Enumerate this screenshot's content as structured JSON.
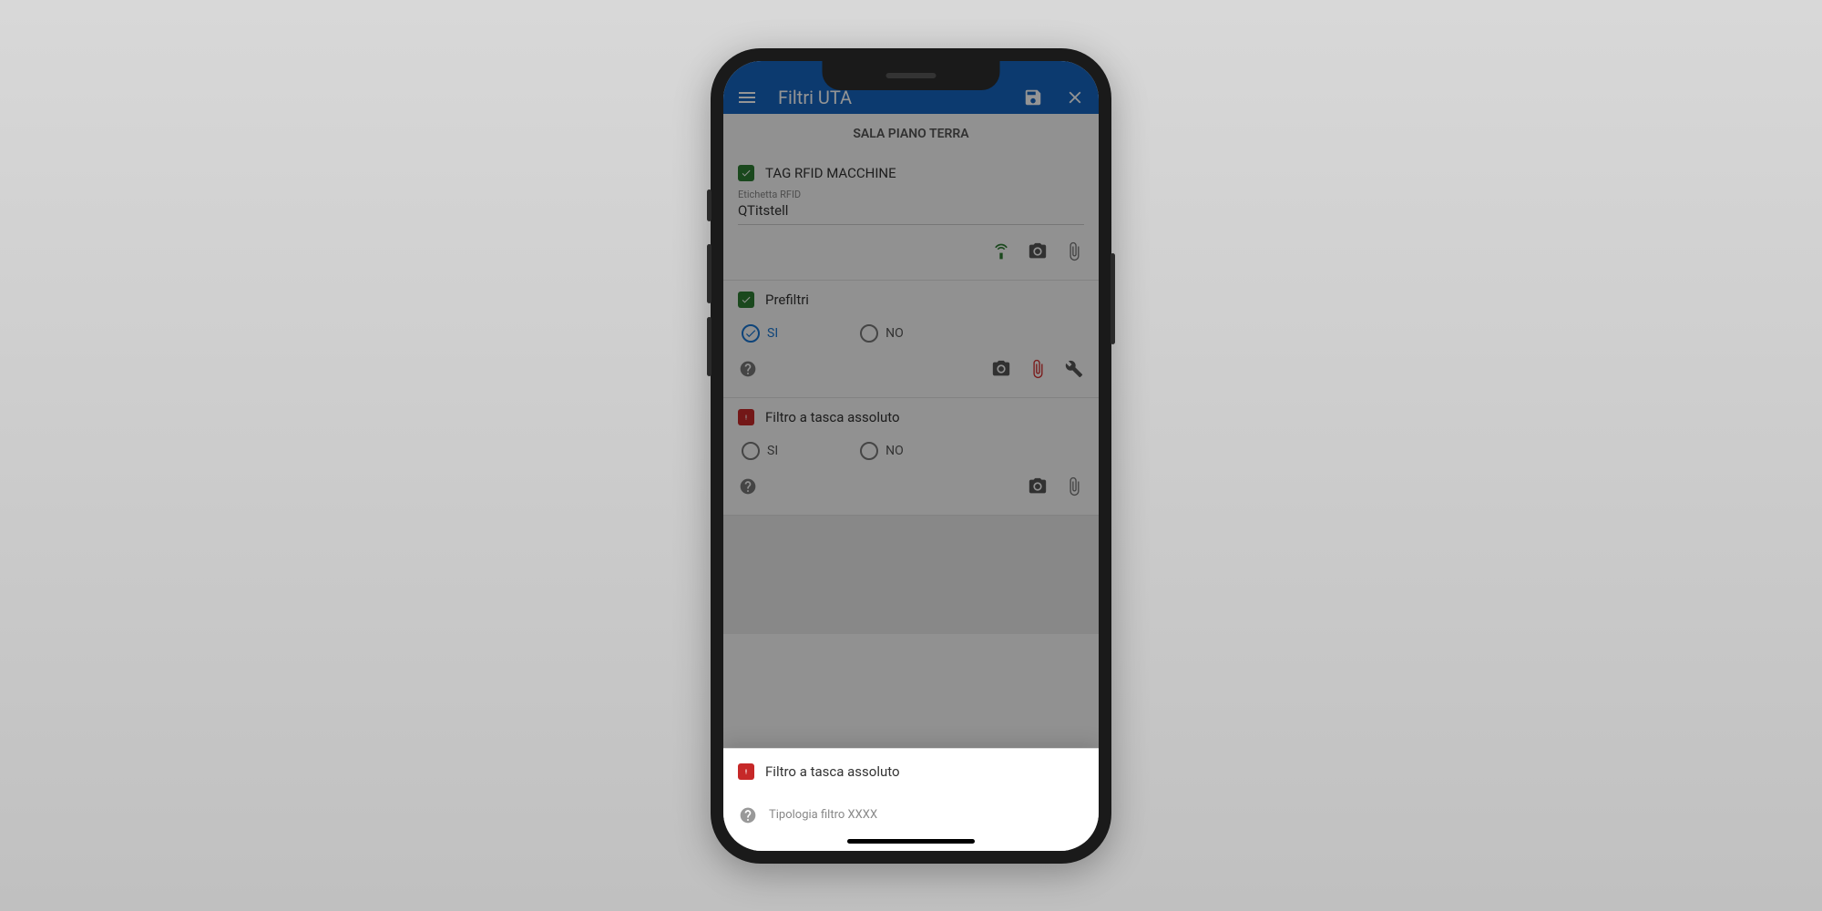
{
  "appbar": {
    "title": "Filtri UTA"
  },
  "subtitle": "SALA PIANO TERRA",
  "sections": {
    "rfid": {
      "title": "TAG RFID MACCHINE",
      "status": "green",
      "field_label": "Etichetta RFID",
      "field_value": "QTitstell"
    },
    "prefiltri": {
      "title": "Prefiltri",
      "status": "green",
      "option_yes": "SI",
      "option_no": "NO",
      "selected": "SI"
    },
    "filtro_tasca": {
      "title": "Filtro a tasca assoluto",
      "status": "red",
      "option_yes": "SI",
      "option_no": "NO"
    }
  },
  "bottom_sheet": {
    "title": "Filtro a tasca assoluto",
    "status": "red",
    "help_text": "Tipologia filtro XXXX"
  },
  "colors": {
    "primary": "#1565c0",
    "accent_green": "#2e7d32",
    "accent_red": "#c62828",
    "attachment_red": "#d32f2f",
    "rfid_green": "#2e7d32"
  }
}
